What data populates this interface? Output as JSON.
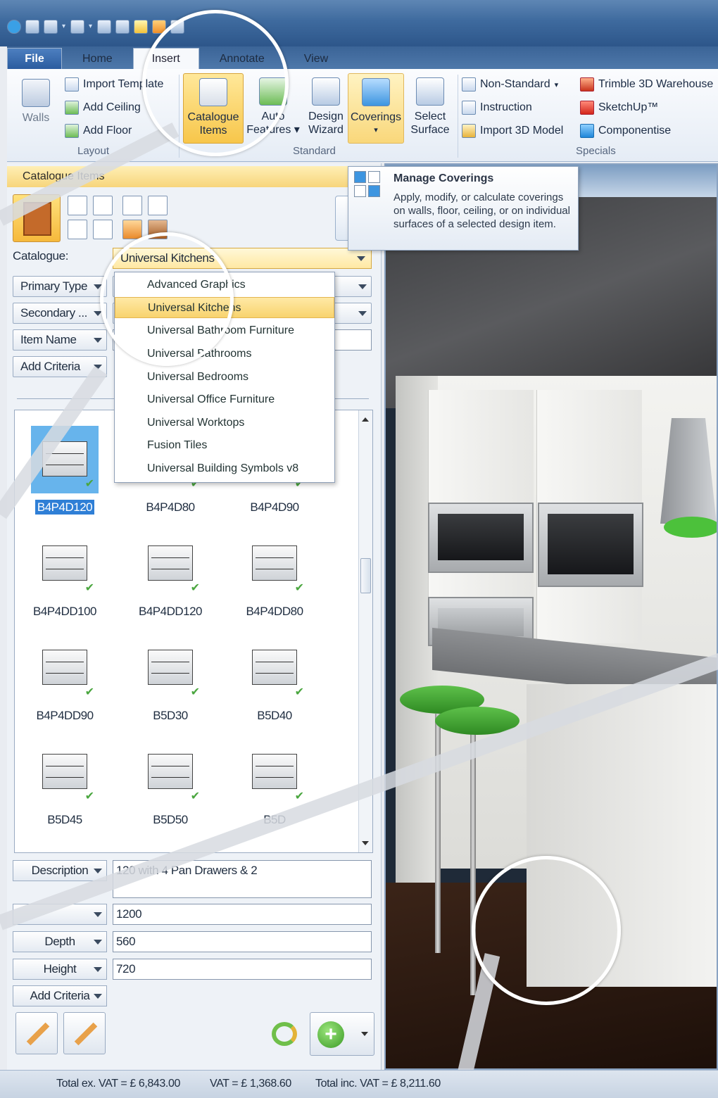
{
  "ribbon": {
    "tabs": [
      "File",
      "Home",
      "Insert",
      "Annotate",
      "View"
    ],
    "active_tab": "Insert",
    "layout_group": {
      "walls": "Walls",
      "import_template": "Import Template",
      "add_ceiling": "Add Ceiling",
      "add_floor": "Add Floor",
      "label": "Layout"
    },
    "standard_group": {
      "catalogue_items": [
        "Catalogue",
        "Items"
      ],
      "auto_features": [
        "Auto",
        "Features"
      ],
      "design_wizard": [
        "Design",
        "Wizard"
      ],
      "coverings": "Coverings",
      "select_surface": [
        "Select",
        "Surface"
      ],
      "label": "Standard"
    },
    "specials_group": {
      "non_standard": "Non-Standard",
      "instruction": "Instruction",
      "import_3d_model": "Import 3D Model",
      "trimble": "Trimble 3D Warehouse",
      "sketchup": "SketchUp™",
      "componentise": "Componentise",
      "label": "Specials"
    }
  },
  "tooltip": {
    "title": "Manage Coverings",
    "text": "Apply, modify, or calculate coverings on walls, floor, ceiling, or on individual surfaces of a selected design item."
  },
  "panel": {
    "title": "Catalogue Items",
    "catalogue_label": "Catalogue:",
    "catalogue_value": "Universal Kitchens",
    "filters": [
      "Primary Type",
      "Secondary ...",
      "Item Name",
      "Add Criteria"
    ],
    "catalogue_options": [
      "Advanced Graphics",
      "Universal Kitchens",
      "Universal Bathroom Furniture",
      "Universal Bathrooms",
      "Universal Bedrooms",
      "Universal Office Furniture",
      "Universal Worktops",
      "Fusion Tiles",
      "Universal Building Symbols v8"
    ],
    "items": [
      "B4P4D120",
      "B4P4D80",
      "B4P4D90",
      "B4P4DD100",
      "B4P4DD120",
      "B4P4DD80",
      "B4P4DD90",
      "B5D30",
      "B5D40",
      "B5D45",
      "B5D50",
      "B5D"
    ],
    "selected_item": "B4P4D120",
    "properties": {
      "description_label": "Description",
      "description_value": "120     with 4 Pan Drawers & 2",
      "width_value": "1200",
      "depth_label": "Depth",
      "depth_value": "560",
      "height_label": "Height",
      "height_value": "720",
      "add_criteria": "Add Criteria"
    }
  },
  "status": {
    "total_ex_vat": "Total ex. VAT = £ 6,843.00",
    "vat": "VAT = £ 1,368.60",
    "total_inc_vat": "Total inc. VAT = £ 8,211.60"
  },
  "colors": {
    "accent": "#f7c64a",
    "ribbon": "#3e6a9e",
    "selection": "#2f7fd6",
    "check": "#4aa63f"
  }
}
